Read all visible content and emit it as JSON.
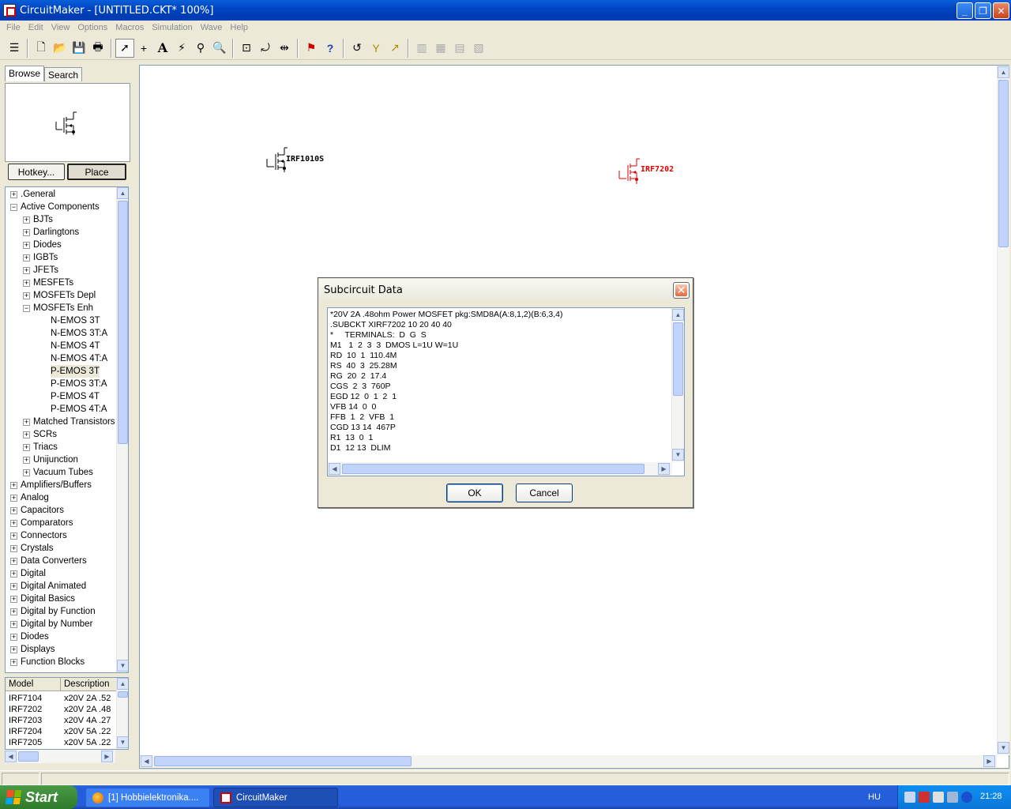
{
  "window": {
    "title": "CircuitMaker - [UNTITLED.CKT* 100%]",
    "min_label": "_",
    "max_label": "❐",
    "close_label": "✕"
  },
  "menu": [
    "File",
    "Edit",
    "View",
    "Options",
    "Macros",
    "Simulation",
    "Wave",
    "Help"
  ],
  "browser": {
    "tabs": [
      "Browse",
      "Search"
    ],
    "hotkey_label": "Hotkey...",
    "place_label": "Place",
    "tree": [
      {
        "label": ".General",
        "level": 0,
        "sign": "+"
      },
      {
        "label": "Active Components",
        "level": 0,
        "sign": "-"
      },
      {
        "label": "BJTs",
        "level": 1,
        "sign": "+"
      },
      {
        "label": "Darlingtons",
        "level": 1,
        "sign": "+"
      },
      {
        "label": "Diodes",
        "level": 1,
        "sign": "+"
      },
      {
        "label": "IGBTs",
        "level": 1,
        "sign": "+"
      },
      {
        "label": "JFETs",
        "level": 1,
        "sign": "+"
      },
      {
        "label": "MESFETs",
        "level": 1,
        "sign": "+"
      },
      {
        "label": "MOSFETs Depl",
        "level": 1,
        "sign": "+"
      },
      {
        "label": "MOSFETs Enh",
        "level": 1,
        "sign": "-"
      },
      {
        "label": "N-EMOS 3T",
        "level": 2,
        "sign": ""
      },
      {
        "label": "N-EMOS 3T:A",
        "level": 2,
        "sign": ""
      },
      {
        "label": "N-EMOS 4T",
        "level": 2,
        "sign": ""
      },
      {
        "label": "N-EMOS 4T:A",
        "level": 2,
        "sign": ""
      },
      {
        "label": "P-EMOS 3T",
        "level": 2,
        "sign": "",
        "selected": true
      },
      {
        "label": "P-EMOS 3T:A",
        "level": 2,
        "sign": ""
      },
      {
        "label": "P-EMOS 4T",
        "level": 2,
        "sign": ""
      },
      {
        "label": "P-EMOS 4T:A",
        "level": 2,
        "sign": ""
      },
      {
        "label": "Matched Transistors",
        "level": 1,
        "sign": "+"
      },
      {
        "label": "SCRs",
        "level": 1,
        "sign": "+"
      },
      {
        "label": "Triacs",
        "level": 1,
        "sign": "+"
      },
      {
        "label": "Unijunction",
        "level": 1,
        "sign": "+"
      },
      {
        "label": "Vacuum Tubes",
        "level": 1,
        "sign": "+"
      },
      {
        "label": "Amplifiers/Buffers",
        "level": 0,
        "sign": "+"
      },
      {
        "label": "Analog",
        "level": 0,
        "sign": "+"
      },
      {
        "label": "Capacitors",
        "level": 0,
        "sign": "+"
      },
      {
        "label": "Comparators",
        "level": 0,
        "sign": "+"
      },
      {
        "label": "Connectors",
        "level": 0,
        "sign": "+"
      },
      {
        "label": "Crystals",
        "level": 0,
        "sign": "+"
      },
      {
        "label": "Data Converters",
        "level": 0,
        "sign": "+"
      },
      {
        "label": "Digital",
        "level": 0,
        "sign": "+"
      },
      {
        "label": "Digital Animated",
        "level": 0,
        "sign": "+"
      },
      {
        "label": "Digital Basics",
        "level": 0,
        "sign": "+"
      },
      {
        "label": "Digital by Function",
        "level": 0,
        "sign": "+"
      },
      {
        "label": "Digital by Number",
        "level": 0,
        "sign": "+"
      },
      {
        "label": "Diodes",
        "level": 0,
        "sign": "+"
      },
      {
        "label": "Displays",
        "level": 0,
        "sign": "+"
      },
      {
        "label": "Function Blocks",
        "level": 0,
        "sign": "+"
      }
    ],
    "model_table": {
      "headers": [
        "Model",
        "Description"
      ],
      "rows": [
        [
          "IRF7104",
          "x20V 2A .52"
        ],
        [
          "IRF7202",
          "x20V 2A .48"
        ],
        [
          "IRF7203",
          "x20V 4A .27"
        ],
        [
          "IRF7204",
          "x20V 5A .22"
        ],
        [
          "IRF7205",
          "x20V 5A .22"
        ]
      ]
    }
  },
  "canvas": {
    "components": [
      {
        "label": "IRF1010S",
        "color": "#000000"
      },
      {
        "label": "IRF7202",
        "color": "#e00000"
      }
    ]
  },
  "dialog": {
    "title": "Subcircuit Data",
    "lines": [
      "*20V 2A .48ohm Power MOSFET pkg:SMD8A(A:8,1,2)(B:6,3,4)",
      ".SUBCKT XIRF7202 10 20 40 40",
      "*     TERMINALS:  D  G  S",
      "M1   1  2  3  3  DMOS L=1U W=1U",
      "RD  10  1  110.4M",
      "RS  40  3  25.28M",
      "RG  20  2  17.4",
      "CGS  2  3  760P",
      "EGD 12  0  1  2  1",
      "VFB 14  0  0",
      "FFB  1  2  VFB  1",
      "CGD 13 14  467P",
      "R1  13  0  1",
      "D1  12 13  DLIM"
    ],
    "ok_label": "OK",
    "cancel_label": "Cancel"
  },
  "taskbar": {
    "start_label": "Start",
    "tasks": [
      "[1] Hobbielektronika....",
      "CircuitMaker"
    ],
    "language": "HU",
    "clock": "21:28"
  }
}
